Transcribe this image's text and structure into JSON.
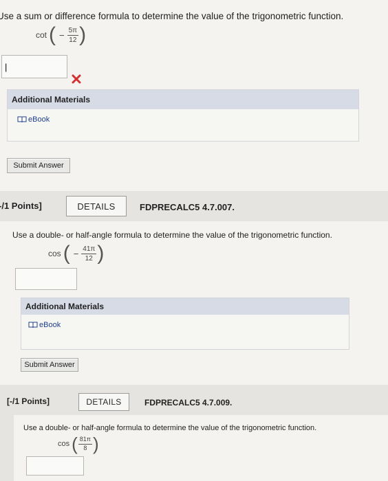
{
  "q1": {
    "prompt": "Use a sum or difference formula to determine the value of the trigonometric function.",
    "func": "cot",
    "sign": "−",
    "num": "5π",
    "den": "12",
    "answer_value": "|",
    "incorrect_mark": "✕",
    "additional_materials": "Additional Materials",
    "ebook": "eBook",
    "submit": "Submit Answer"
  },
  "q2": {
    "points": "-/1 Points]",
    "details": "DETAILS",
    "code": "FDPRECALC5 4.7.007.",
    "prompt": "Use a double- or half-angle formula to determine the value of the trigonometric function.",
    "func": "cos",
    "sign": "−",
    "num": "41π",
    "den": "12",
    "additional_materials": "Additional Materials",
    "ebook": "eBook",
    "submit": "Submit Answer"
  },
  "q3": {
    "points": "[-/1 Points]",
    "details": "DETAILS",
    "code": "FDPRECALC5 4.7.009.",
    "prompt": "Use a double- or half-angle formula to determine the value of the trigonometric function.",
    "func": "cos",
    "num": "81π",
    "den": "8"
  },
  "colors": {
    "background": "#e6e4e0",
    "panel": "#f4f3f0",
    "am_header": "#d6dbe6",
    "incorrect": "#d32f2f",
    "ebook_link": "#1f3f8a"
  }
}
